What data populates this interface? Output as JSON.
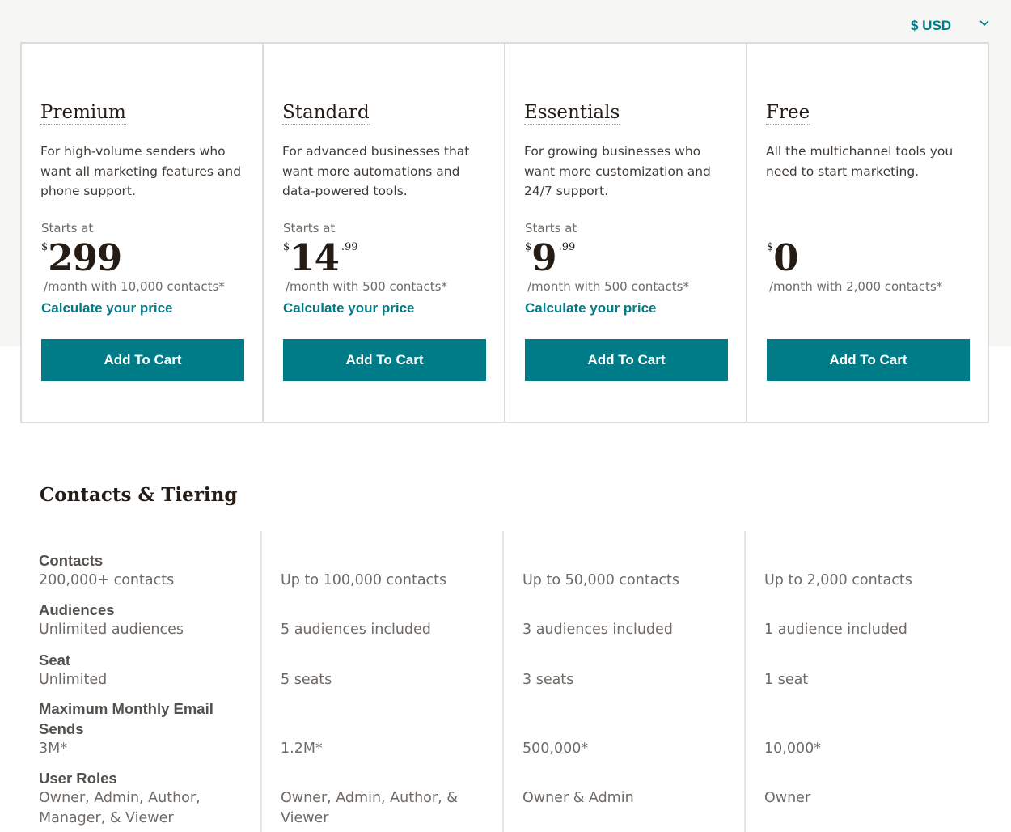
{
  "currency": {
    "label": "$ USD"
  },
  "colors": {
    "accent": "#007c89",
    "text": "#241c15",
    "muted": "#6f6a66",
    "border": "#dcdcd8"
  },
  "plans": [
    {
      "name": "Premium",
      "description": "For high-volume senders who want all marketing features and phone support.",
      "starts_at": "Starts at",
      "currency_symbol": "$",
      "price": "299",
      "cents": "",
      "per_month": "/month with 10,000 contacts*",
      "calc_link": "Calculate your price",
      "cta": "Add To Cart"
    },
    {
      "name": "Standard",
      "description": "For advanced businesses that want more automations and data-powered tools.",
      "starts_at": "Starts at",
      "currency_symbol": "$",
      "price": "14",
      "cents": ".99",
      "per_month": "/month with 500 contacts*",
      "calc_link": "Calculate your price",
      "cta": "Add To Cart"
    },
    {
      "name": "Essentials",
      "description": "For growing businesses who want more customization and 24/7 support.",
      "starts_at": "Starts at",
      "currency_symbol": "$",
      "price": "9",
      "cents": ".99",
      "per_month": "/month with 500 contacts*",
      "calc_link": "Calculate your price",
      "cta": "Add To Cart"
    },
    {
      "name": "Free",
      "description": "All the multichannel tools you need to start marketing.",
      "starts_at": "",
      "currency_symbol": "$",
      "price": "0",
      "cents": "",
      "per_month": "/month with 2,000 contacts*",
      "calc_link": "",
      "cta": "Add To Cart"
    }
  ],
  "tiering": {
    "title": "Contacts & Tiering",
    "rows": [
      {
        "label": "Contacts",
        "values": [
          "200,000+ contacts",
          "Up to 100,000 contacts",
          "Up to 50,000 contacts",
          "Up to 2,000 contacts"
        ]
      },
      {
        "label": "Audiences",
        "values": [
          "Unlimited audiences",
          "5 audiences included",
          "3 audiences included",
          "1 audience included"
        ]
      },
      {
        "label": "Seat",
        "values": [
          "Unlimited",
          "5 seats",
          "3 seats",
          "1 seat"
        ]
      },
      {
        "label": "Maximum Monthly Email Sends",
        "values": [
          "3M*",
          "1.2M*",
          "500,000*",
          "10,000*"
        ]
      },
      {
        "label": "User Roles",
        "values": [
          "Owner, Admin, Author, Manager, & Viewer",
          "Owner, Admin, Author, & Viewer",
          "Owner & Admin",
          "Owner"
        ]
      }
    ]
  }
}
